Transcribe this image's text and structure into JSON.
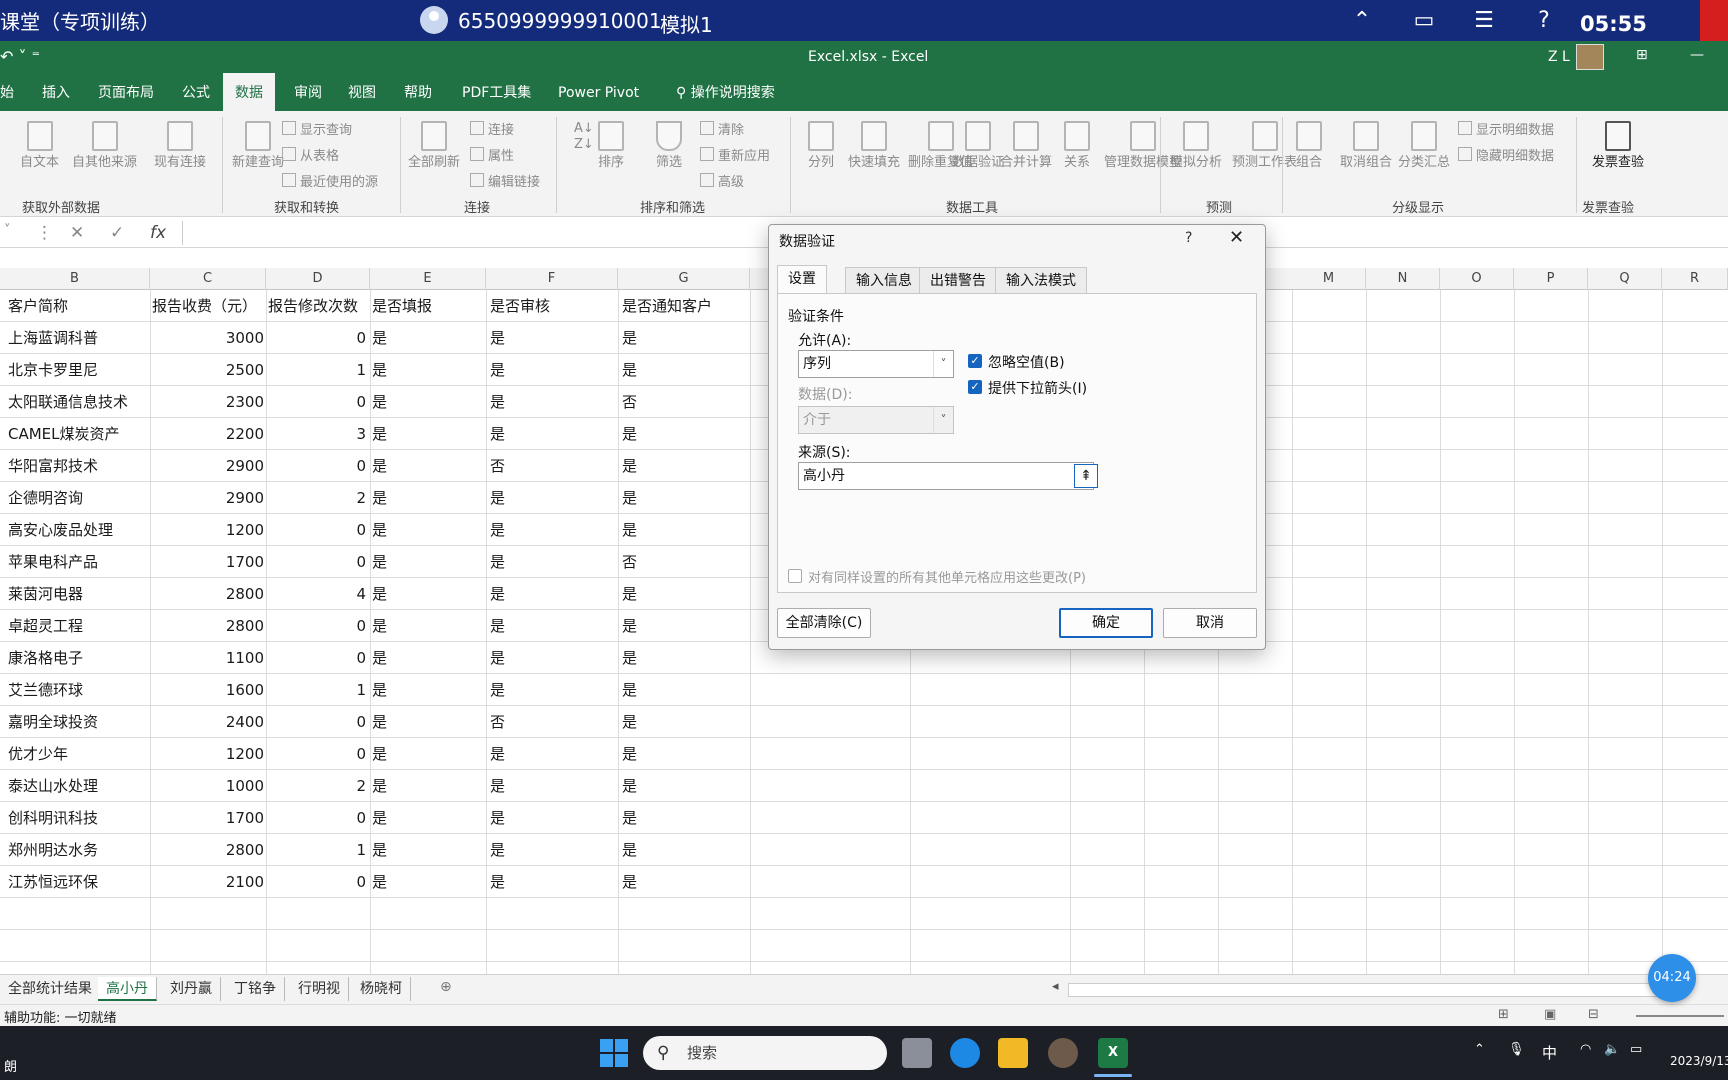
{
  "topbar": {
    "title": "课堂（专项训练）",
    "user_id": "6550999999910001",
    "mode": "模拟1",
    "clock": "05:55",
    "icons": [
      "collapse-icon",
      "window-icon",
      "list-icon",
      "help-icon"
    ]
  },
  "excel_title": {
    "document": "Excel.xlsx  -  Excel",
    "user": "Z L"
  },
  "menu": {
    "tabs": [
      "始",
      "插入",
      "页面布局",
      "公式",
      "数据",
      "审阅",
      "视图",
      "帮助",
      "PDF工具集",
      "Power Pivot",
      "操作说明搜索"
    ],
    "active": "数据"
  },
  "ribbon": {
    "groups": [
      {
        "label": "获取外部数据",
        "buttons": [
          "自文本",
          "自其他来源",
          "现有连接"
        ]
      },
      {
        "label": "获取和转换",
        "buttons": [
          "新建查询"
        ],
        "small": [
          "显示查询",
          "从表格",
          "最近使用的源"
        ]
      },
      {
        "label": "连接",
        "buttons": [
          "全部刷新"
        ],
        "small": [
          "连接",
          "属性",
          "编辑链接"
        ]
      },
      {
        "label": "排序和筛选",
        "buttons": [
          "排序",
          "筛选"
        ],
        "small": [
          "清除",
          "重新应用",
          "高级"
        ]
      },
      {
        "label": "数据工具",
        "buttons": [
          "分列",
          "快速填充",
          "删除重复值",
          "数据验证",
          "合并计算",
          "关系",
          "管理数据模型"
        ]
      },
      {
        "label": "预测",
        "buttons": [
          "模拟分析",
          "预测工作表"
        ]
      },
      {
        "label": "分级显示",
        "buttons": [
          "组合",
          "取消组合",
          "分类汇总"
        ],
        "small": [
          "显示明细数据",
          "隐藏明细数据"
        ]
      },
      {
        "label": "发票查验",
        "buttons": [
          "发票查验"
        ]
      }
    ]
  },
  "formula_bar": {
    "fx": "fx"
  },
  "columns": [
    "B",
    "C",
    "D",
    "E",
    "F",
    "G",
    "M",
    "N",
    "O",
    "P",
    "Q",
    "R"
  ],
  "table": {
    "headers": [
      "客户简称",
      "报告收费（元）",
      "报告修改次数",
      "是否填报",
      "是否审核",
      "是否通知客户"
    ],
    "rows": [
      [
        "上海蓝调科普",
        "3000",
        "0",
        "是",
        "是",
        "是"
      ],
      [
        "北京卡罗里尼",
        "2500",
        "1",
        "是",
        "是",
        "是"
      ],
      [
        "太阳联通信息技术",
        "2300",
        "0",
        "是",
        "是",
        "否"
      ],
      [
        "CAMEL煤炭资产",
        "2200",
        "3",
        "是",
        "是",
        "是"
      ],
      [
        "华阳富邦技术",
        "2900",
        "0",
        "是",
        "否",
        "是"
      ],
      [
        "企德明咨询",
        "2900",
        "2",
        "是",
        "是",
        "是"
      ],
      [
        "高安心废品处理",
        "1200",
        "0",
        "是",
        "是",
        "是"
      ],
      [
        "苹果电科产品",
        "1700",
        "0",
        "是",
        "是",
        "否"
      ],
      [
        "莱茵河电器",
        "2800",
        "4",
        "是",
        "是",
        "是"
      ],
      [
        "卓超灵工程",
        "2800",
        "0",
        "是",
        "是",
        "是"
      ],
      [
        "康洛格电子",
        "1100",
        "0",
        "是",
        "是",
        "是"
      ],
      [
        "艾兰德环球",
        "1600",
        "1",
        "是",
        "是",
        "是"
      ],
      [
        "嘉明全球投资",
        "2400",
        "0",
        "是",
        "否",
        "是"
      ],
      [
        "优才少年",
        "1200",
        "0",
        "是",
        "是",
        "是"
      ],
      [
        "泰达山水处理",
        "1000",
        "2",
        "是",
        "是",
        "是"
      ],
      [
        "创科明讯科技",
        "1700",
        "0",
        "是",
        "是",
        "是"
      ],
      [
        "郑州明达水务",
        "2800",
        "1",
        "是",
        "是",
        "是"
      ],
      [
        "江苏恒远环保",
        "2100",
        "0",
        "是",
        "是",
        "是"
      ]
    ]
  },
  "sheets": {
    "tabs": [
      "全部统计结果",
      "高小丹",
      "刘丹赢",
      "丁铭争",
      "行明视",
      "杨晓柯"
    ],
    "active": "高小丹"
  },
  "status": {
    "text": "辅助功能: 一切就绪"
  },
  "dialog": {
    "title": "数据验证",
    "help": "?",
    "close": "✕",
    "tabs": [
      "设置",
      "输入信息",
      "出错警告",
      "输入法模式"
    ],
    "active_tab": "设置",
    "section": "验证条件",
    "allow_label": "允许(A):",
    "allow_value": "序列",
    "data_label": "数据(D):",
    "data_value": "介于",
    "ignore_blank": "忽略空值(B)",
    "dropdown": "提供下拉箭头(I)",
    "source_label": "来源(S):",
    "source_value": "高小丹",
    "apply_all": "对有同样设置的所有其他单元格应用这些更改(P)",
    "clear_all": "全部清除(C)",
    "ok": "确定",
    "cancel": "取消"
  },
  "timer": "04:24",
  "taskbar": {
    "left_text": "朗",
    "search_placeholder": "搜索",
    "ime": "中",
    "date": "2023/9/13"
  }
}
